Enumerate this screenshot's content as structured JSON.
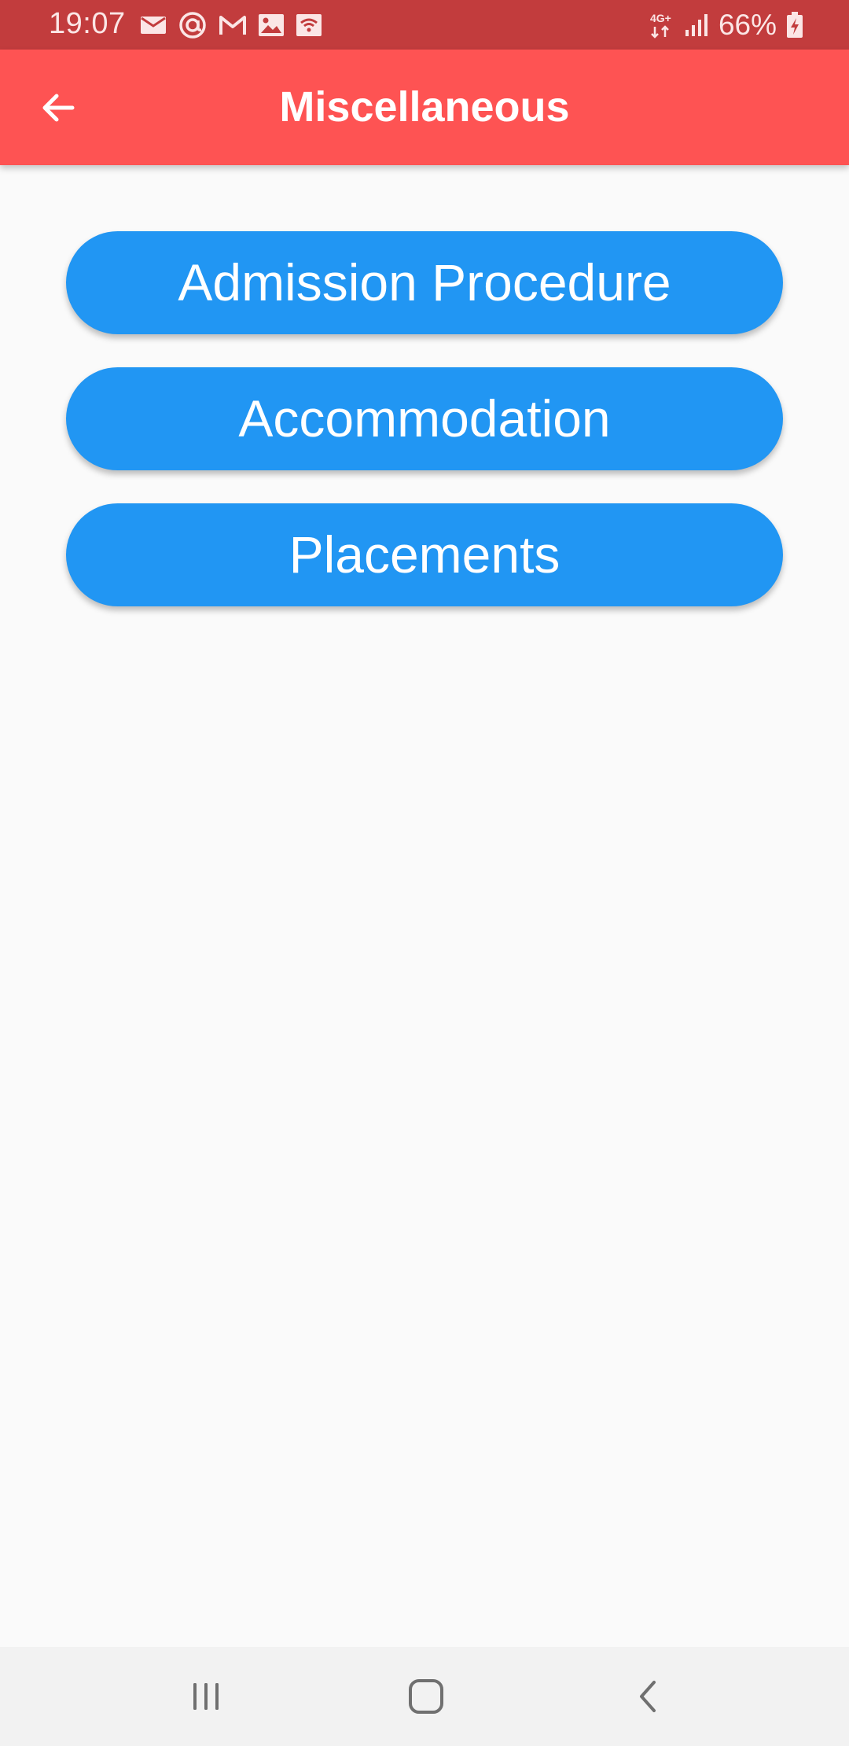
{
  "status_bar": {
    "time": "19:07",
    "network_type": "4G+",
    "battery_percent": "66%",
    "notification_icons": [
      "email-icon",
      "at-sign-icon",
      "gmail-icon",
      "image-icon",
      "wifi-hotspot-icon"
    ]
  },
  "app_bar": {
    "title": "Miscellaneous",
    "back_icon": "arrow-left-icon"
  },
  "menu": {
    "buttons": [
      {
        "label": "Admission Procedure"
      },
      {
        "label": "Accommodation"
      },
      {
        "label": "Placements"
      }
    ]
  },
  "navigation_bar": {
    "items": [
      "recents-icon",
      "home-icon",
      "back-icon"
    ]
  },
  "colors": {
    "status_bar": "#c23c3d",
    "app_bar": "#fe5353",
    "button": "#2196f3",
    "background": "#fafafa",
    "nav_bar": "#f2f2f2"
  }
}
